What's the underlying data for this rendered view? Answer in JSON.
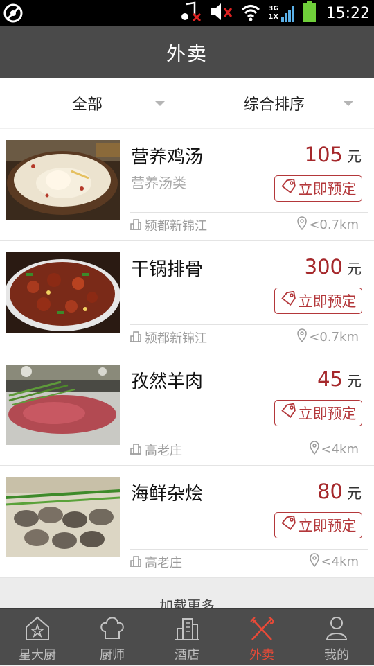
{
  "status_bar": {
    "time": "15:22",
    "left_icon": "blocked-icon",
    "right_icons": [
      "music-muted-icon",
      "volume-muted-icon",
      "wifi-icon",
      "signal-3g-icon",
      "battery-icon"
    ],
    "signal_labels": [
      "3G",
      "1X"
    ]
  },
  "header": {
    "title": "外卖"
  },
  "filters": [
    {
      "label": "全部"
    },
    {
      "label": "综合排序"
    }
  ],
  "items": [
    {
      "name": "营养鸡汤",
      "category": "营养汤类",
      "price": "105",
      "unit": "元",
      "book_label": "立即预定",
      "location": "颍都新锦江",
      "distance": "<0.7km"
    },
    {
      "name": "干锅排骨",
      "category": "",
      "price": "300",
      "unit": "元",
      "book_label": "立即预定",
      "location": "颍都新锦江",
      "distance": "<0.7km"
    },
    {
      "name": "孜然羊肉",
      "category": "",
      "price": "45",
      "unit": "元",
      "book_label": "立即预定",
      "location": "高老庄",
      "distance": "<4km"
    },
    {
      "name": "海鲜杂烩",
      "category": "",
      "price": "80",
      "unit": "元",
      "book_label": "立即预定",
      "location": "高老庄",
      "distance": "<4km"
    }
  ],
  "load_more": {
    "label": "加载更多"
  },
  "nav": [
    {
      "label": "星大厨",
      "icon": "house-star-icon",
      "active": false
    },
    {
      "label": "厨师",
      "icon": "chef-hat-icon",
      "active": false
    },
    {
      "label": "酒店",
      "icon": "building-icon",
      "active": false
    },
    {
      "label": "外卖",
      "icon": "fork-knife-icon",
      "active": true
    },
    {
      "label": "我的",
      "icon": "person-icon",
      "active": false
    }
  ],
  "colors": {
    "accent": "#e84a38",
    "price": "#a5282b",
    "header_bg": "#4a4a4a",
    "nav_bg": "#4c4c4c"
  }
}
